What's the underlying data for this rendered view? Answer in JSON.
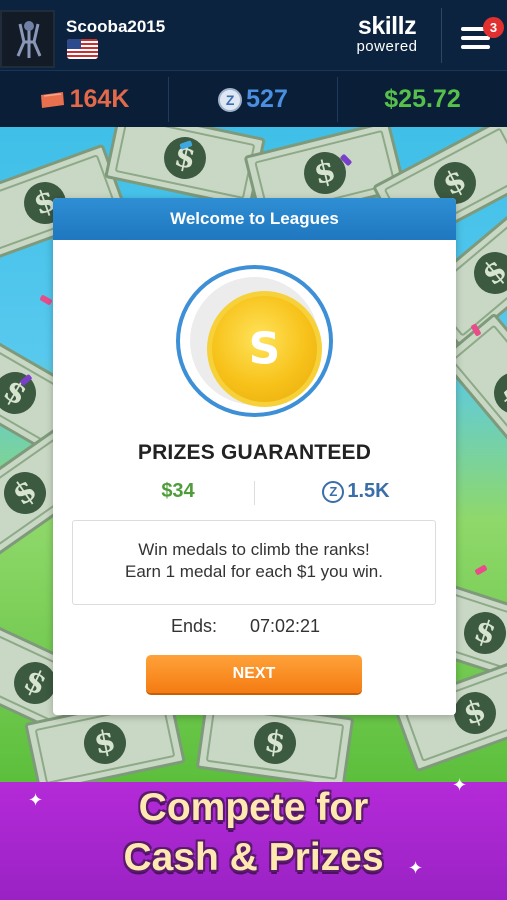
{
  "header": {
    "username": "Scooba2015",
    "brand_line1": "skillz",
    "brand_line2": "powered",
    "menu_badge": "3",
    "flag_icon": "us-flag-icon",
    "menu_icon": "hamburger-menu-icon"
  },
  "stats": {
    "tickets": "164K",
    "z_coins": "527",
    "cash": "$25.72",
    "z_symbol": "Z"
  },
  "modal": {
    "header": "Welcome to Leagues",
    "medal_letter": "S",
    "prizes_title": "PRIZES GUARANTEED",
    "prize_cash": "$34",
    "prize_z": "1.5K",
    "z_symbol": "Z",
    "info_line1": "Win medals to climb the ranks!",
    "info_line2": "Earn 1 medal for each $1 you win.",
    "ends_label": "Ends:",
    "ends_time": "07:02:21",
    "next_label": "NEXT"
  },
  "banner": {
    "line1": "Compete for",
    "line2": "Cash & Prizes"
  },
  "colors": {
    "header_bg": "#0c2340",
    "tickets": "#e26a4a",
    "z_coins": "#4a8fe0",
    "cash": "#56c04a",
    "modal_header": "#1f77bf",
    "next_button": "#f47c12",
    "banner_bg": "#b42ad8"
  }
}
